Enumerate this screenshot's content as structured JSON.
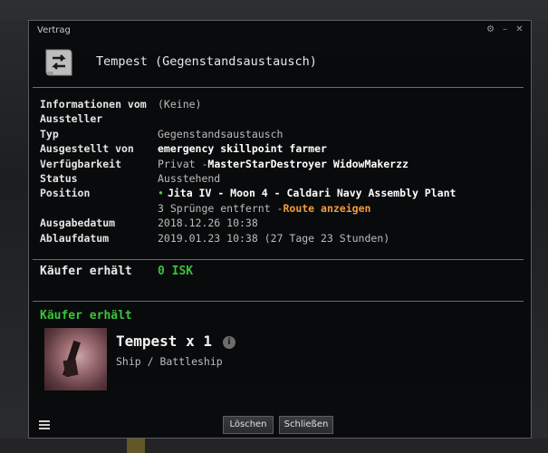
{
  "window": {
    "title": "Vertrag"
  },
  "header": {
    "title": "Tempest  (Gegenstandsaustausch)"
  },
  "info": {
    "rows": [
      {
        "label": "Informationen vom",
        "value": "(Keine)"
      },
      {
        "label": "Aussteller",
        "value": ""
      },
      {
        "label": "Typ",
        "value": "Gegenstandsaustausch"
      },
      {
        "label": "Ausgestellt von",
        "value": "emergency skillpoint farmer"
      },
      {
        "label": "Verfügbarkeit",
        "value_prefix": "Privat - ",
        "value": "MasterStarDestroyer WidowMakerzz"
      },
      {
        "label": "Status",
        "value": "Ausstehend"
      },
      {
        "label": "Position",
        "value": "Jita IV - Moon 4 - Caldari Navy Assembly Plant"
      },
      {
        "label": "",
        "value_prefix": "3 Sprünge entfernt - ",
        "value": "Route anzeigen"
      },
      {
        "label": "Ausgabedatum",
        "value": "2018.12.26 10:38"
      },
      {
        "label": "Ablaufdatum",
        "value": "2019.01.23 10:38 (27 Tage 23 Stunden)"
      }
    ]
  },
  "buyer": {
    "label": "Käufer erhält",
    "amount": "0 ISK"
  },
  "items_section": {
    "heading": "Käufer erhält",
    "item": {
      "name": "Tempest x 1",
      "type": "Ship / Battleship",
      "info_icon": "i"
    }
  },
  "buttons": {
    "delete": "Löschen",
    "close": "Schließen"
  },
  "icons": {
    "settings": "⚙",
    "minimize": "–",
    "close": "✕"
  },
  "colors": {
    "accent_green": "#39c13a",
    "link_orange": "#f39c3a"
  }
}
